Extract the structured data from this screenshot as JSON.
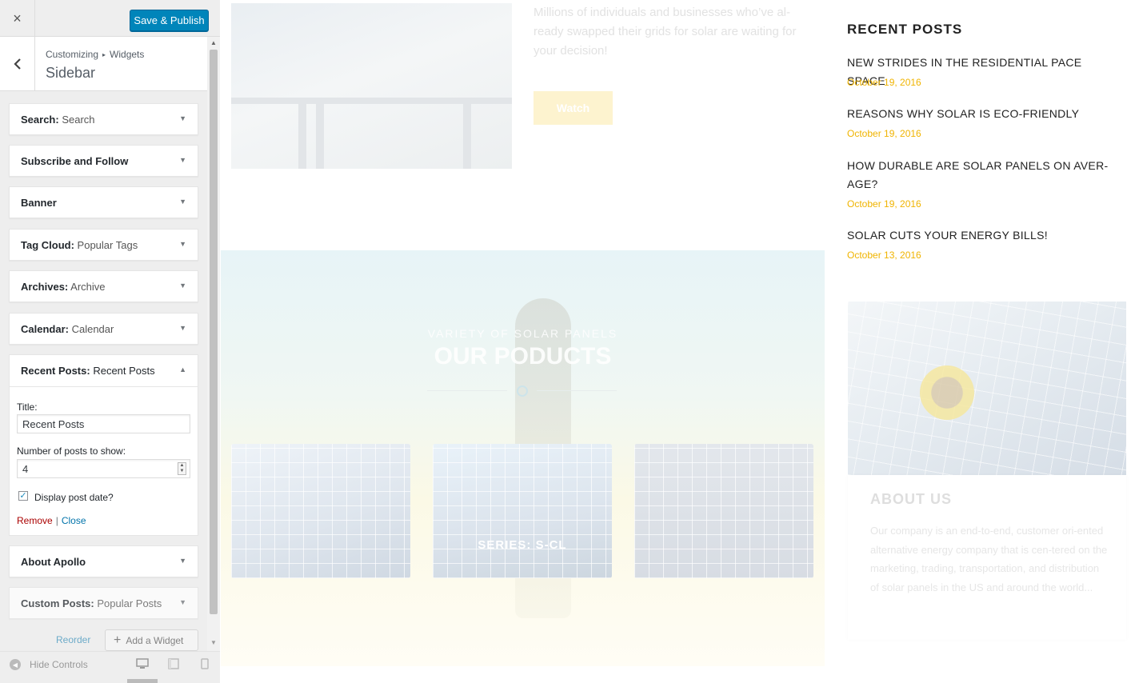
{
  "customizer": {
    "close_icon": "×",
    "publish_label": "Save & Publish",
    "breadcrumb": {
      "root": "Customizing",
      "separator": "▸",
      "child": "Widgets"
    },
    "section_title": "Sidebar",
    "widgets": [
      {
        "type": "Search:",
        "name": "Search"
      },
      {
        "type": "Subscribe and Follow",
        "name": ""
      },
      {
        "type": "Banner",
        "name": ""
      },
      {
        "type": "Tag Cloud:",
        "name": "Popular Tags"
      },
      {
        "type": "Archives:",
        "name": "Archive"
      },
      {
        "type": "Calendar:",
        "name": "Calendar"
      },
      {
        "type": "About Apollo",
        "name": ""
      },
      {
        "type": "Custom Posts:",
        "name": "Popular Posts"
      }
    ],
    "expanded_widget": {
      "type": "Recent Posts:",
      "name": "Recent Posts",
      "title_label": "Title:",
      "title_value": "Recent Posts",
      "count_label": "Number of posts to show:",
      "count_value": "4",
      "date_checkbox_label": "Display post date?",
      "date_checked": true,
      "remove_label": "Remove",
      "separator": "|",
      "close_label": "Close"
    },
    "reorder_label": "Reorder",
    "add_widget_label": "Add a Widget",
    "hide_controls_label": "Hide Controls",
    "icons": {
      "back": "chevron-left-icon",
      "collapse": "triangle-down-icon",
      "expand": "triangle-up-icon",
      "devices": [
        "desktop-icon",
        "tablet-icon",
        "mobile-icon"
      ]
    },
    "colors": {
      "publish": "#0085ba",
      "remove": "#aa0000",
      "link": "#0073aa"
    }
  },
  "preview": {
    "hero_text": "Millions of individuals and businesses who’ve al-ready swapped their grids for solar are waiting for your decision!",
    "watch_label": "Watch",
    "products": {
      "kicker": "VARIETY OF SOLAR PANELS",
      "title": "OUR PODUCTS",
      "card_label": "SERIES: S-CL"
    },
    "recent_posts": {
      "heading": "RECENT POSTS",
      "items": [
        {
          "title": "NEW STRIDES IN THE RESIDENTIAL PACE SPACE",
          "date": "October 19, 2016"
        },
        {
          "title": "REASONS WHY SOLAR IS ECO-FRIENDLY",
          "date": "October 19, 2016"
        },
        {
          "title": "HOW DURABLE ARE SOLAR PANELS ON AVER-AGE?",
          "date": "October 19, 2016"
        },
        {
          "title": "SOLAR CUTS YOUR ENERGY BILLS!",
          "date": "October 13, 2016"
        }
      ]
    },
    "about": {
      "title": "ABOUT US",
      "text": "Our company is an end-to-end, customer ori-ented alternative energy company that is cen-tered on the marketing, trading, transportation, and distribution of solar panels in the US and around the world..."
    },
    "colors": {
      "date": "#f0b400",
      "heading": "#222222"
    }
  }
}
